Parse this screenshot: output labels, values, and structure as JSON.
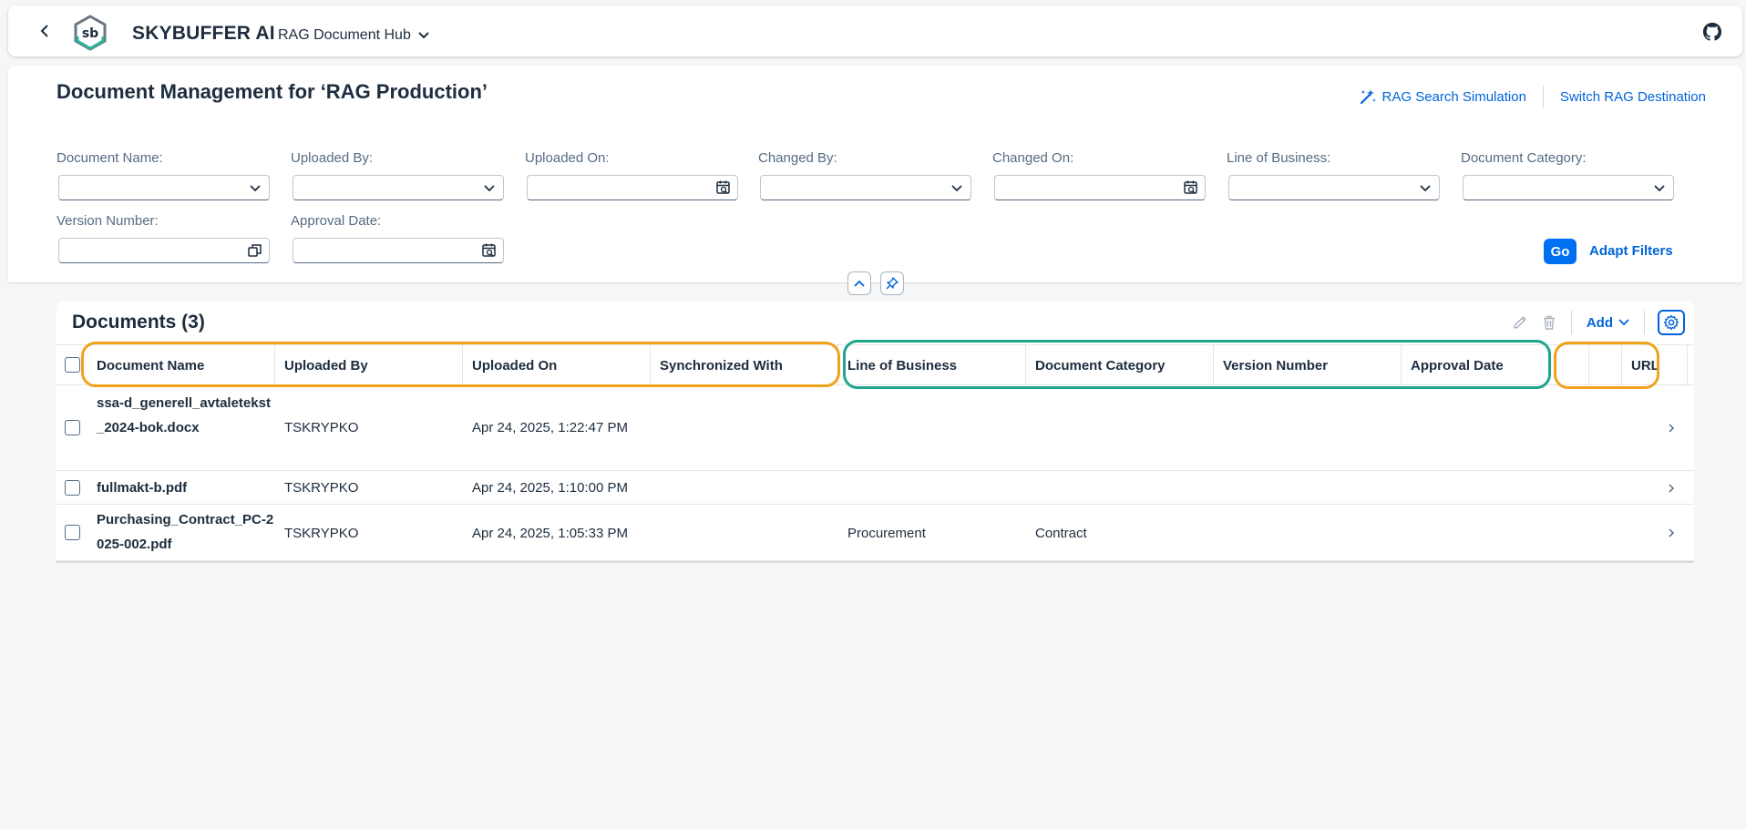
{
  "shell": {
    "brand": "SKYBUFFER AI",
    "logo_text": "sb",
    "app_name": "RAG Document Hub"
  },
  "page": {
    "title": "Document Management for ‘RAG Production’",
    "actions": {
      "search_simulation": "RAG Search Simulation",
      "switch_destination": "Switch RAG Destination"
    }
  },
  "filters": {
    "document_name": "Document Name:",
    "uploaded_by": "Uploaded By:",
    "uploaded_on": "Uploaded On:",
    "changed_by": "Changed By:",
    "changed_on": "Changed On:",
    "line_of_business": "Line of Business:",
    "document_category": "Document Category:",
    "version_number": "Version Number:",
    "approval_date": "Approval Date:",
    "go": "Go",
    "adapt": "Adapt Filters"
  },
  "table": {
    "title": "Documents (3)",
    "add_label": "Add",
    "columns": [
      "Document Name",
      "Uploaded By",
      "Uploaded On",
      "Synchronized With",
      "Line of Business",
      "Document Category",
      "Version Number",
      "Approval Date",
      "",
      "URL"
    ],
    "rows": [
      {
        "name": "ssa-d_generell_avtaletekst_2024-bok.docx",
        "uploaded_by": "TSKRYPKO",
        "uploaded_on": "Apr 24, 2025, 1:22:47 PM",
        "synchronized_with": "",
        "line_of_business": "",
        "document_category": "",
        "version_number": "",
        "approval_date": "",
        "url": ""
      },
      {
        "name": "fullmakt-b.pdf",
        "uploaded_by": "TSKRYPKO",
        "uploaded_on": "Apr 24, 2025, 1:10:00 PM",
        "synchronized_with": "",
        "line_of_business": "",
        "document_category": "",
        "version_number": "",
        "approval_date": "",
        "url": ""
      },
      {
        "name": "Purchasing_Contract_PC-2025-002.pdf",
        "uploaded_by": "TSKRYPKO",
        "uploaded_on": "Apr 24, 2025, 1:05:33 PM",
        "synchronized_with": "",
        "line_of_business": "Procurement",
        "document_category": "Contract",
        "version_number": "",
        "approval_date": "",
        "url": ""
      }
    ]
  },
  "icons": {
    "back": "chevron-left-icon",
    "app_switch": "chevron-down-icon",
    "github": "github-icon",
    "search_sim": "magic-wand-icon",
    "dropdown": "chevron-down-icon",
    "date": "calendar-icon",
    "value_help": "value-help-icon",
    "collapse": "chevron-up-icon",
    "pin": "pin-icon",
    "edit": "pencil-icon",
    "delete": "trash-icon",
    "settings": "gear-icon",
    "row_nav": "chevron-right-icon"
  },
  "colors": {
    "accent": "#0070f2",
    "link": "#0064d9",
    "highlight_orange": "#f0a21b",
    "highlight_teal": "#20a58c"
  }
}
